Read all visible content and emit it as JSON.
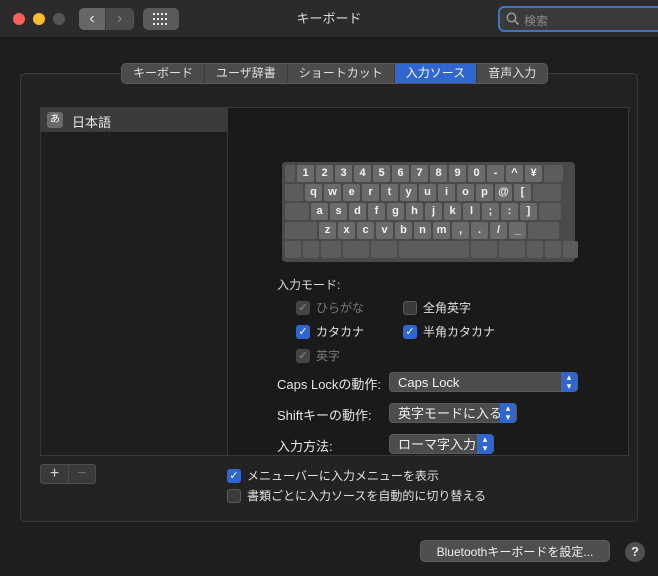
{
  "window": {
    "title": "キーボード"
  },
  "toolbar": {
    "search_placeholder": "検索"
  },
  "tabs": [
    {
      "label": "キーボード",
      "active": false
    },
    {
      "label": "ユーザ辞書",
      "active": false
    },
    {
      "label": "ショートカット",
      "active": false
    },
    {
      "label": "入力ソース",
      "active": true
    },
    {
      "label": "音声入力",
      "active": false
    }
  ],
  "sources": {
    "badge": "あ",
    "label": "日本語"
  },
  "keyboard": {
    "row1": [
      "1",
      "2",
      "3",
      "4",
      "5",
      "6",
      "7",
      "8",
      "9",
      "0",
      "-",
      "^",
      "¥"
    ],
    "row2": [
      "q",
      "w",
      "e",
      "r",
      "t",
      "y",
      "u",
      "i",
      "o",
      "p",
      "@",
      "["
    ],
    "row3": [
      "a",
      "s",
      "d",
      "f",
      "g",
      "h",
      "j",
      "k",
      "l",
      ";",
      ":",
      "]"
    ],
    "row4": [
      "z",
      "x",
      "c",
      "v",
      "b",
      "n",
      "m",
      ",",
      ".",
      "/",
      "_"
    ]
  },
  "input_modes": {
    "label": "入力モード:",
    "hiragana": "ひらがな",
    "zenkaku_eiji": "全角英字",
    "katakana": "カタカナ",
    "hankaku_katakana": "半角カタカナ",
    "eiji": "英字"
  },
  "settings": {
    "capslock_label": "Caps Lockの動作:",
    "capslock_value": "Caps Lock",
    "shift_label": "Shiftキーの動作:",
    "shift_value": "英字モードに入る",
    "method_label": "入力方法:",
    "method_value": "ローマ字入力"
  },
  "list_controls": {
    "plus": "+",
    "minus": "−"
  },
  "options": {
    "show_menu": "メニューバーに入力メニューを表示",
    "auto_switch": "書類ごとに入力ソースを自動的に切り替える"
  },
  "footer": {
    "bluetooth_button": "Bluetoothキーボードを設定...",
    "help": "?"
  },
  "colors": {
    "accent": "#2f66d0",
    "window_bg": "#1e1e1e"
  }
}
